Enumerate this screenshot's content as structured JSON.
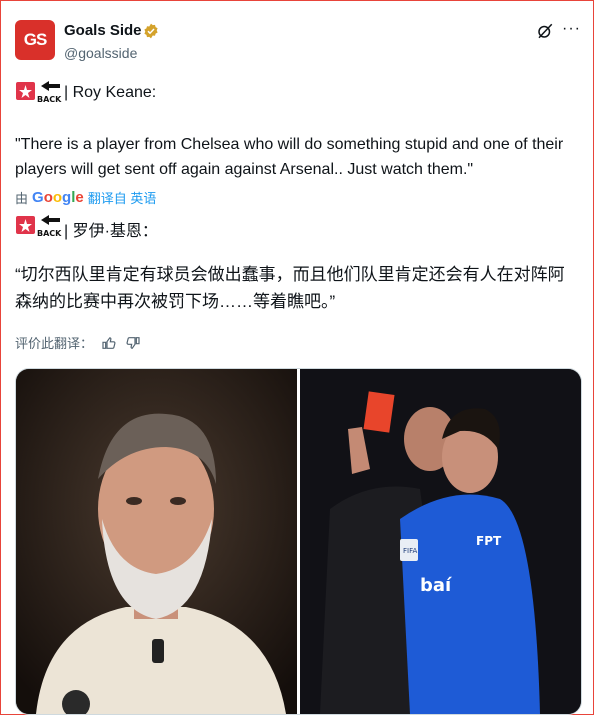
{
  "author": {
    "name": "Goals Side",
    "handle": "@goalsside",
    "avatar_text": "GS",
    "verified_color": "#d4a22b"
  },
  "header_icons": [
    "grok-icon",
    "more-icon"
  ],
  "post": {
    "speaker_line": "| Roy Keane:",
    "quote": "\"There is a player from Chelsea who will do something stupid and one of their players will get sent off again against Arsenal.. Just watch them.\"",
    "translation_prefix": "由",
    "translation_brand": "Google",
    "translation_link": "翻译自 英语",
    "speaker_line_translated": "| 罗伊·基恩：",
    "quote_translated": "“切尔西队里肯定有球员会做出蠢事，而且他们队里肯定还会有人在对阵阿森纳的比赛中再次被罚下场……等着瞧吧。”",
    "rate_label": "评价此翻译：",
    "back_label": "BACK"
  },
  "media": {
    "photo_left": "Roy Keane portrait",
    "photo_right": "Referee showing red card to Chelsea player",
    "kit_sponsor": "FPT",
    "kit_text": "baí",
    "referee_badge": "FIFA"
  },
  "colors": {
    "accent": "#1d9bf0",
    "brand_red": "#d9302a",
    "chelsea_blue": "#1e5bd6",
    "red_card": "#e8452b"
  }
}
